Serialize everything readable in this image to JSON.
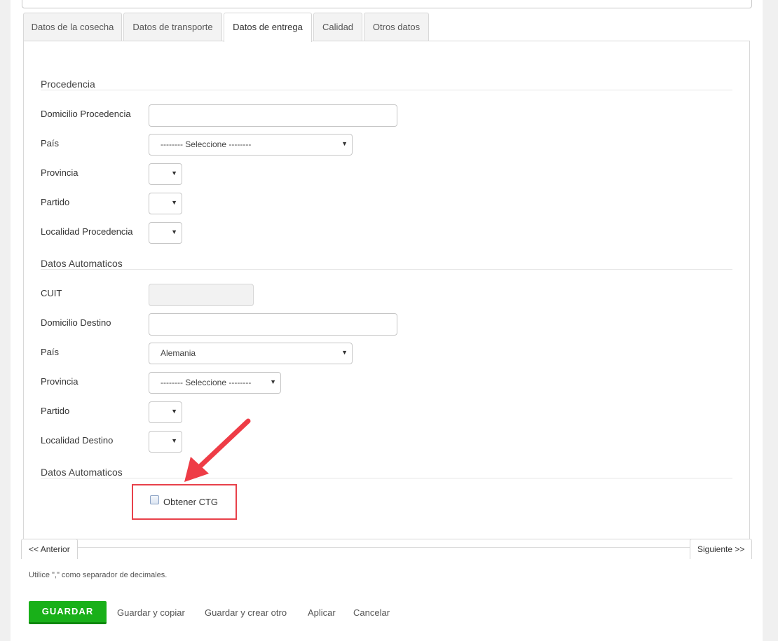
{
  "tabs": [
    {
      "label": "Datos de la cosecha"
    },
    {
      "label": "Datos de transporte"
    },
    {
      "label": "Datos de entrega"
    },
    {
      "label": "Calidad"
    },
    {
      "label": "Otros datos"
    }
  ],
  "active_tab": "Datos de entrega",
  "procedencia": {
    "title": "Procedencia",
    "domicilio_label": "Domicilio Procedencia",
    "domicilio_value": "",
    "pais_label": "País",
    "pais_value": "-------- Seleccione --------",
    "provincia_label": "Provincia",
    "provincia_value": "",
    "partido_label": "Partido",
    "partido_value": "",
    "localidad_label": "Localidad Procedencia",
    "localidad_value": ""
  },
  "destino": {
    "title": "Datos Automaticos",
    "cuit_label": "CUIT",
    "cuit_value": "",
    "domicilio_label": "Domicilio Destino",
    "domicilio_value": "",
    "pais_label": "País",
    "pais_value": "Alemania",
    "provincia_label": "Provincia",
    "provincia_value": "-------- Seleccione --------",
    "partido_label": "Partido",
    "partido_value": "",
    "localidad_label": "Localidad Destino",
    "localidad_value": ""
  },
  "ctg": {
    "title": "Datos Automaticos",
    "checkbox_label": "Obtener CTG",
    "checked": false
  },
  "pager": {
    "prev_label": "<< Anterior",
    "next_label": "Siguiente >>"
  },
  "hint": "Utilice \",\" como separador de decimales.",
  "actions": {
    "save_label": "GUARDAR",
    "save_copy_label": "Guardar y copiar",
    "save_new_label": "Guardar y crear otro",
    "apply_label": "Aplicar",
    "cancel_label": "Cancelar"
  },
  "colors": {
    "save_button": "#19b019",
    "highlight": "#e8414a",
    "arrow": "#ee3c46"
  },
  "icons": {
    "caret": "caret-down-icon",
    "annotation": "arrow-pointer-icon"
  }
}
